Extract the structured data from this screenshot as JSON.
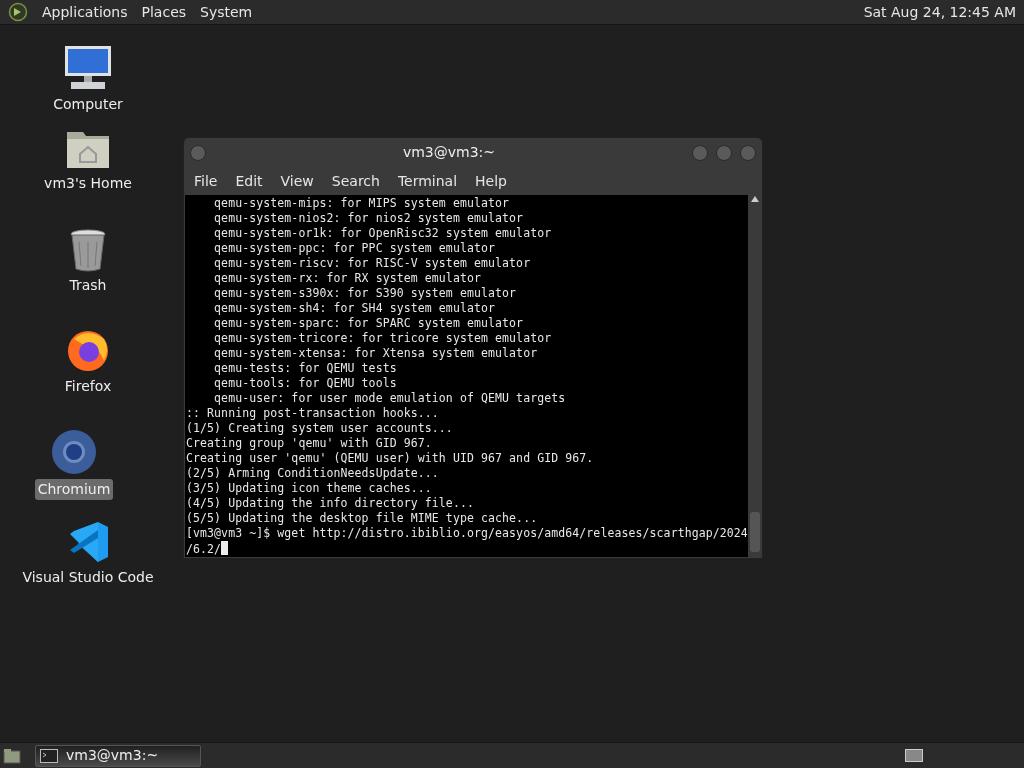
{
  "top_panel": {
    "menus": [
      "Applications",
      "Places",
      "System"
    ],
    "clock": "Sat Aug 24, 12:45 AM"
  },
  "desktop_icons": [
    {
      "kind": "computer",
      "label": "Computer",
      "selected": false
    },
    {
      "kind": "home",
      "label": "vm3's Home",
      "selected": false
    },
    {
      "kind": "trash",
      "label": "Trash",
      "selected": false
    },
    {
      "kind": "firefox",
      "label": "Firefox",
      "selected": false
    },
    {
      "kind": "chromium",
      "label": "Chromium",
      "selected": true
    },
    {
      "kind": "vscode",
      "label": "Visual Studio Code",
      "selected": false
    }
  ],
  "terminal": {
    "title": "vm3@vm3:~",
    "menu": [
      "File",
      "Edit",
      "View",
      "Search",
      "Terminal",
      "Help"
    ],
    "lines": [
      "    qemu-system-mips: for MIPS system emulator",
      "    qemu-system-nios2: for nios2 system emulator",
      "    qemu-system-or1k: for OpenRisc32 system emulator",
      "    qemu-system-ppc: for PPC system emulator",
      "    qemu-system-riscv: for RISC-V system emulator",
      "    qemu-system-rx: for RX system emulator",
      "    qemu-system-s390x: for S390 system emulator",
      "    qemu-system-sh4: for SH4 system emulator",
      "    qemu-system-sparc: for SPARC system emulator",
      "    qemu-system-tricore: for tricore system emulator",
      "    qemu-system-xtensa: for Xtensa system emulator",
      "    qemu-tests: for QEMU tests",
      "    qemu-tools: for QEMU tools",
      "    qemu-user: for user mode emulation of QEMU targets",
      ":: Running post-transaction hooks...",
      "(1/5) Creating system user accounts...",
      "Creating group 'qemu' with GID 967.",
      "Creating user 'qemu' (QEMU user) with UID 967 and GID 967.",
      "(2/5) Arming ConditionNeedsUpdate...",
      "(3/5) Updating icon theme caches...",
      "(4/5) Updating the info directory file...",
      "(5/5) Updating the desktop file MIME type cache...",
      "[vm3@vm3 ~]$ wget http://distro.ibiblio.org/easyos/amd64/releases/scarthgap/2024",
      "/6.2/"
    ]
  },
  "taskbar": {
    "tasks": [
      {
        "label": "vm3@vm3:~",
        "selected": true
      }
    ]
  }
}
